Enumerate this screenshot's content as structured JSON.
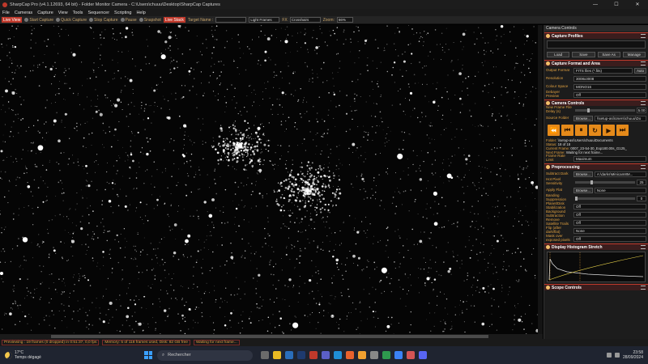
{
  "window": {
    "title": "SharpCap Pro (v4.1.12693, 64 bit) - Folder Monitor Camera - C:\\Users\\chuuu\\Desktop\\SharpCap Captures",
    "min": "—",
    "max": "☐",
    "close": "✕"
  },
  "menu": [
    "File",
    "Cameras",
    "Capture",
    "View",
    "Tools",
    "Sequencer",
    "Scripting",
    "Help"
  ],
  "toolbar": {
    "live_view": "Live View",
    "start_capture": "Start Capture",
    "quick_capture": "Quick Capture",
    "stop_capture": "Stop Capture",
    "pause": "Pause",
    "snapshot": "Snapshot",
    "live_stack": "Live Stack",
    "target_name_label": "Target Name :",
    "target_name_value": "",
    "frame_type": "Light Frames",
    "fx_label": "FX",
    "fx_value": "Crosshairs",
    "zoom_label": "Zoom:",
    "zoom_value": "66%"
  },
  "panel": {
    "title": "Camera Controls",
    "capture_profiles": {
      "header": "Capture Profiles",
      "buttons": [
        "Load",
        "Save",
        "Save As",
        "Manage"
      ]
    },
    "format_area": {
      "header": "Capture Format and Area",
      "rows": [
        {
          "label": "Output Format",
          "value": "FITS files (*.fits)",
          "extra": "Auto"
        },
        {
          "label": "Resolution",
          "value": "3008x3008"
        },
        {
          "label": "Colour Space",
          "value": "MONO16"
        },
        {
          "label": "Debayer Preview",
          "value": "Off"
        }
      ]
    },
    "camera_controls": {
      "header": "Camera Controls",
      "delay_label": "New Frame File Delay (s)",
      "delay_value": "5.00",
      "delay_level": 0.2,
      "source_folder_label": "Source Folder",
      "source_browse": "Browse...",
      "source_value": "\\\\setup-asi\\Users\\chuuu\\Do",
      "transport": [
        "⏪",
        "⏮",
        "⏸",
        "↻",
        "▶",
        "⏭"
      ],
      "folder_label": "Folder:",
      "folder_value": "\\\\setup-asi\\Users\\chuuu\\Documents",
      "status_label": "Status:",
      "status_value": "18 of 18",
      "current_label": "Current Frame:",
      "current_value": "0007_23-54-30_Exp180.00s_G125_",
      "next_label": "Next Frame:",
      "next_value": "Waiting for next frame...",
      "frame_rate_label": "Frame Rate Limit",
      "frame_rate_value": "Maximum"
    },
    "preprocessing": {
      "header": "Preprocessing",
      "subtract_dark_label": "Subtract Dark",
      "subtract_dark_btn": "Browse...",
      "subtract_dark_value": "A:\\darks\\Minicam8M...",
      "hot_pixel_label": "Hot Pixel Sensitivity",
      "hot_pixel_value": "25",
      "hot_pixel_level": 0.25,
      "apply_flat_label": "Apply Flat",
      "apply_flat_btn": "Browse...",
      "apply_flat_value": "None",
      "banding_label": "Banding Suppression",
      "banding_value": "0",
      "banding_level": 0,
      "rows": [
        {
          "label": "Planet/Disk Stabilization",
          "value": "Off"
        },
        {
          "label": "Background Subtraction",
          "value": "Off"
        },
        {
          "label": "Remove Satellite Trails",
          "value": "Off"
        },
        {
          "label": "Flip (after dark/flat)",
          "value": "None"
        },
        {
          "label": "Mask over exposed pixels",
          "value": "Off"
        }
      ]
    },
    "histogram": {
      "header": "Display Histogram Stretch"
    },
    "scope": {
      "header": "Scope Controls"
    }
  },
  "status": {
    "left": "Previewing : 19 frames (0 dropped) in 0:51:37, 0,0 fps",
    "memory": "Memory: 5 of 118 frames used, Disk: 82 GB free",
    "waiting": "Waiting for next frame..."
  },
  "taskbar": {
    "temp": "17°C",
    "weather": "Temps dégagé",
    "search": "Rechercher",
    "time": "23:58",
    "date": "28/09/2024"
  }
}
